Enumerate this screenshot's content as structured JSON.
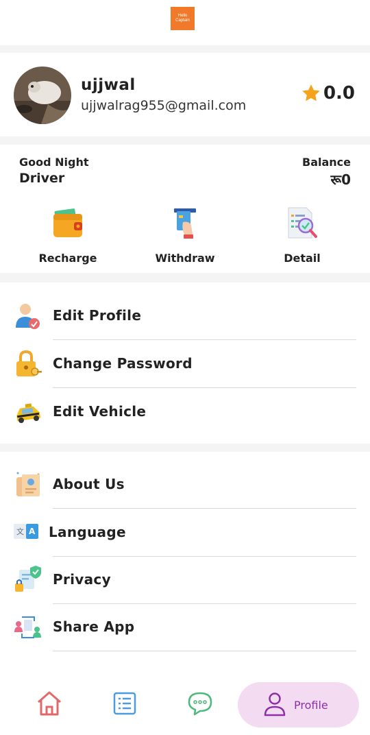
{
  "header": {
    "logo_text": "Hello Captain"
  },
  "profile": {
    "name": "ujjwal",
    "email": "ujjwalrag955@gmail.com",
    "rating": "0.0"
  },
  "balance": {
    "greeting": "Good Night",
    "role": "Driver",
    "label": "Balance",
    "value": "रू0"
  },
  "actions": [
    {
      "label": "Recharge",
      "icon": "wallet-icon"
    },
    {
      "label": "Withdraw",
      "icon": "atm-card-icon"
    },
    {
      "label": "Detail",
      "icon": "document-search-icon"
    }
  ],
  "menu_account": [
    {
      "label": "Edit Profile",
      "icon": "user-edit-icon"
    },
    {
      "label": "Change Password",
      "icon": "padlock-key-icon"
    },
    {
      "label": "Edit Vehicle",
      "icon": "taxi-car-icon"
    }
  ],
  "menu_general": [
    {
      "label": "About Us",
      "icon": "id-card-icon"
    },
    {
      "label": "Language",
      "icon": "translate-icon"
    },
    {
      "label": "Privacy",
      "icon": "privacy-shield-icon"
    },
    {
      "label": "Share App",
      "icon": "share-people-icon"
    }
  ],
  "bottom_nav": {
    "items": [
      {
        "name": "home",
        "icon": "home-icon"
      },
      {
        "name": "list",
        "icon": "list-icon"
      },
      {
        "name": "chat",
        "icon": "chat-bubble-icon"
      }
    ],
    "active_label": "Profile",
    "active_icon": "person-icon"
  },
  "colors": {
    "accent": "#f07a2a",
    "star": "#f5a21c",
    "nav_active_bg": "#f3dcf1",
    "nav_active_fg": "#8e2fa7"
  }
}
